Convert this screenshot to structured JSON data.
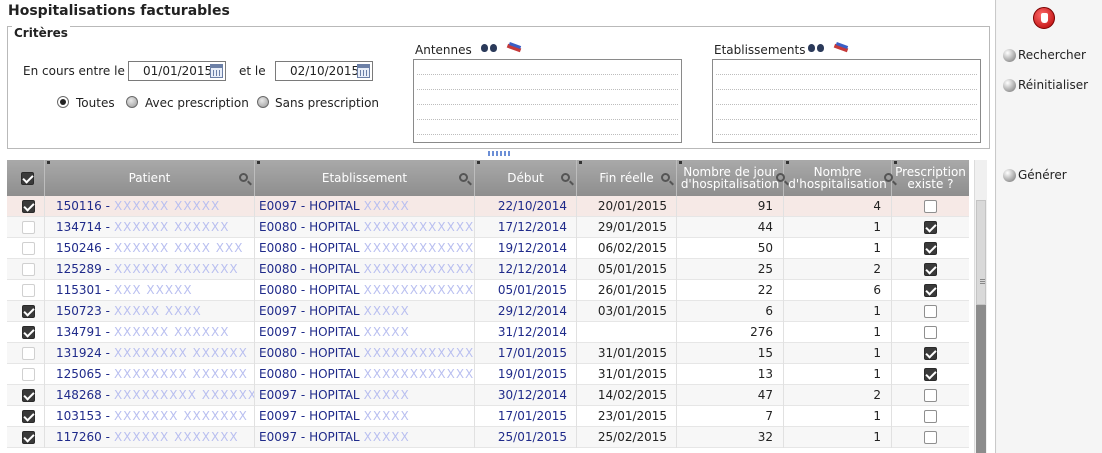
{
  "page": {
    "title": "Hospitalisations facturables"
  },
  "criteria": {
    "legend": "Critères",
    "date_label": "En cours entre le",
    "date_from": "01/01/2015",
    "date_and": "et le",
    "date_to": "02/10/2015",
    "radios": [
      {
        "label": "Toutes",
        "selected": true
      },
      {
        "label": "Avec prescription",
        "selected": false
      },
      {
        "label": "Sans prescription",
        "selected": false
      }
    ],
    "antennes_label": "Antennes",
    "etablissements_label": "Etablissements"
  },
  "sidebar": {
    "search_label": "Rechercher",
    "reset_label": "Réinitialiser",
    "generate_label": "Générer"
  },
  "table": {
    "columns": [
      "Patient",
      "Etablissement",
      "Début",
      "Fin réelle",
      "Nombre de jour d'hospitalisation",
      "Nombre d'hospitalisation",
      "Prescription existe ?"
    ],
    "rows": [
      {
        "checked": true,
        "patient_id": "150116 -",
        "patient_name": "XXXXXX XXXXX",
        "etab": "E0097 - HOPITAL",
        "etab_extra": "XXXXX",
        "debut": "22/10/2014",
        "fin": "20/01/2015",
        "jours": "91",
        "nb": "4",
        "presc": false
      },
      {
        "checked": false,
        "patient_id": "134714 -",
        "patient_name": "XXXXXX XXXXXX",
        "etab": "E0080 - HOPITAL",
        "etab_extra": "XXXXXXXXXXXXXX",
        "debut": "17/12/2014",
        "fin": "29/01/2015",
        "jours": "44",
        "nb": "1",
        "presc": true
      },
      {
        "checked": false,
        "patient_id": "150246 -",
        "patient_name": "XXXXXX XXXX XXX",
        "etab": "E0080 - HOPITAL",
        "etab_extra": "XXXXXXXXXXXXXX",
        "debut": "19/12/2014",
        "fin": "06/02/2015",
        "jours": "50",
        "nb": "1",
        "presc": true
      },
      {
        "checked": false,
        "patient_id": "125289 -",
        "patient_name": "XXXXXX XXXXXXX",
        "etab": "E0080 - HOPITAL",
        "etab_extra": "XXXXXXXXXXXXXX",
        "debut": "12/12/2014",
        "fin": "05/01/2015",
        "jours": "25",
        "nb": "2",
        "presc": true
      },
      {
        "checked": false,
        "patient_id": "115301 -",
        "patient_name": "XXX XXXXX",
        "etab": "E0080 - HOPITAL",
        "etab_extra": "XXXXXXXXXXXXXX",
        "debut": "05/01/2015",
        "fin": "26/01/2015",
        "jours": "22",
        "nb": "6",
        "presc": true
      },
      {
        "checked": true,
        "patient_id": "150723 -",
        "patient_name": "XXXXX XXXX",
        "etab": "E0097 - HOPITAL",
        "etab_extra": "XXXXX",
        "debut": "29/12/2014",
        "fin": "03/01/2015",
        "jours": "6",
        "nb": "1",
        "presc": false
      },
      {
        "checked": true,
        "patient_id": "134791 -",
        "patient_name": "XXXXXX XXXXXX",
        "etab": "E0097 - HOPITAL",
        "etab_extra": "XXXXX",
        "debut": "31/12/2014",
        "fin": "",
        "jours": "276",
        "nb": "1",
        "presc": false
      },
      {
        "checked": false,
        "patient_id": "131924 -",
        "patient_name": "XXXXXXXX XXXXXX",
        "etab": "E0080 - HOPITAL",
        "etab_extra": "XXXXXXXXXXXXXX",
        "debut": "17/01/2015",
        "fin": "31/01/2015",
        "jours": "15",
        "nb": "1",
        "presc": true
      },
      {
        "checked": false,
        "patient_id": "125065 -",
        "patient_name": "XXXXXXXX XXXXXX",
        "etab": "E0080 - HOPITAL",
        "etab_extra": "XXXXXXXXXXXXXX",
        "debut": "19/01/2015",
        "fin": "31/01/2015",
        "jours": "13",
        "nb": "1",
        "presc": true
      },
      {
        "checked": true,
        "patient_id": "148268 -",
        "patient_name": "XXXXXXXXX XXXXXXX",
        "etab": "E0097 - HOPITAL",
        "etab_extra": "XXXXX",
        "debut": "30/12/2014",
        "fin": "14/02/2015",
        "jours": "47",
        "nb": "2",
        "presc": false
      },
      {
        "checked": true,
        "patient_id": "103153 -",
        "patient_name": "XXXXXXX XXXXXXX",
        "etab": "E0097 - HOPITAL",
        "etab_extra": "XXXXX",
        "debut": "17/01/2015",
        "fin": "23/01/2015",
        "jours": "7",
        "nb": "1",
        "presc": false
      },
      {
        "checked": true,
        "patient_id": "117260 -",
        "patient_name": "XXXXXX XXXXXXX",
        "etab": "E0097 - HOPITAL",
        "etab_extra": "XXXXX",
        "debut": "25/01/2015",
        "fin": "25/02/2015",
        "jours": "32",
        "nb": "1",
        "presc": false
      }
    ]
  }
}
